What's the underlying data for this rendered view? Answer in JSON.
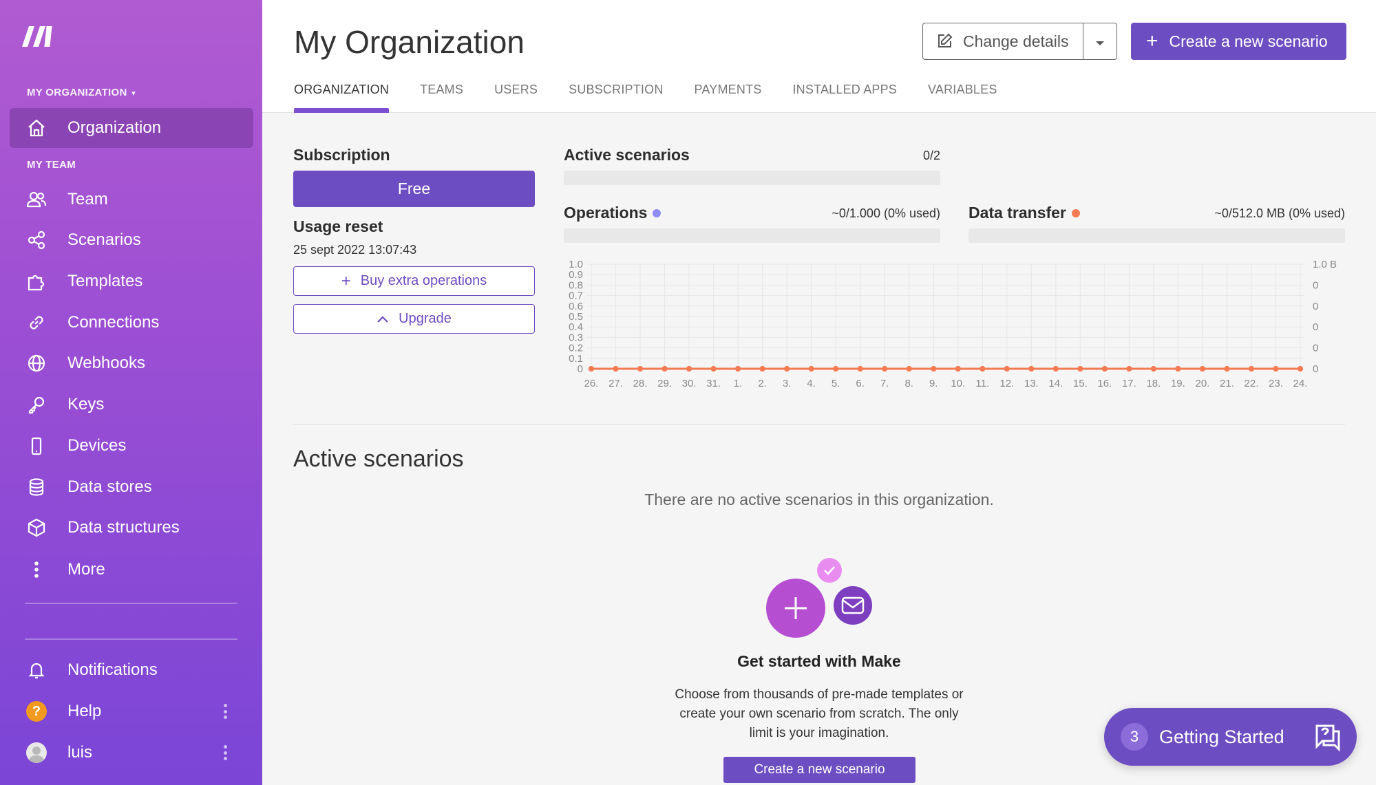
{
  "sidebar": {
    "org_section": "MY ORGANIZATION",
    "team_section": "MY TEAM",
    "items": [
      {
        "label": "Organization"
      },
      {
        "label": "Team"
      },
      {
        "label": "Scenarios"
      },
      {
        "label": "Templates"
      },
      {
        "label": "Connections"
      },
      {
        "label": "Webhooks"
      },
      {
        "label": "Keys"
      },
      {
        "label": "Devices"
      },
      {
        "label": "Data stores"
      },
      {
        "label": "Data structures"
      },
      {
        "label": "More"
      }
    ],
    "bottom": [
      {
        "label": "Notifications"
      },
      {
        "label": "Help",
        "badge": "?"
      },
      {
        "label": "luis"
      }
    ]
  },
  "header": {
    "title": "My Organization",
    "change_details": "Change details",
    "create_scenario": "Create a new scenario",
    "tabs": [
      "ORGANIZATION",
      "TEAMS",
      "USERS",
      "SUBSCRIPTION",
      "PAYMENTS",
      "INSTALLED APPS",
      "VARIABLES"
    ]
  },
  "subscription": {
    "label": "Subscription",
    "plan": "Free",
    "usage_reset_label": "Usage reset",
    "usage_reset_date": "25 sept 2022 13:07:43",
    "buy_extra": "Buy extra operations",
    "upgrade": "Upgrade"
  },
  "stats": {
    "active_scenarios_label": "Active scenarios",
    "active_scenarios_value": "0/2",
    "active_scenarios_fraction": 0,
    "operations_label": "Operations",
    "operations_value": "~0/1.000 (0% used)",
    "operations_fraction": 0,
    "data_transfer_label": "Data transfer",
    "data_transfer_value": "~0/512.0 MB (0% used)",
    "data_transfer_fraction": 0
  },
  "colors": {
    "accent": "#6d4dc2",
    "operations_dot": "#8f8cf5",
    "data_transfer_dot": "#f47a52",
    "line": "#f47a52"
  },
  "chart_data": {
    "type": "line",
    "x": [
      "26.",
      "27.",
      "28.",
      "29.",
      "30.",
      "31.",
      "1.",
      "2.",
      "3.",
      "4.",
      "5.",
      "6.",
      "7.",
      "8.",
      "9.",
      "10.",
      "11.",
      "12.",
      "13.",
      "14.",
      "15.",
      "16.",
      "17.",
      "18.",
      "19.",
      "20.",
      "21.",
      "22.",
      "23.",
      "24."
    ],
    "y_left_ticks": [
      "0",
      "0.1",
      "0.2",
      "0.3",
      "0.4",
      "0.5",
      "0.6",
      "0.7",
      "0.8",
      "0.9",
      "1.0"
    ],
    "y_right_ticks": [
      "0",
      "0",
      "0",
      "0",
      "0",
      "1.0 B"
    ],
    "ylim": [
      0,
      1
    ],
    "grid": true,
    "series": [
      {
        "values": [
          0,
          0,
          0,
          0,
          0,
          0,
          0,
          0,
          0,
          0,
          0,
          0,
          0,
          0,
          0,
          0,
          0,
          0,
          0,
          0,
          0,
          0,
          0,
          0,
          0,
          0,
          0,
          0,
          0,
          0
        ]
      },
      {
        "values": [
          0,
          0,
          0,
          0,
          0,
          0,
          0,
          0,
          0,
          0,
          0,
          0,
          0,
          0,
          0,
          0,
          0,
          0,
          0,
          0,
          0,
          0,
          0,
          0,
          0,
          0,
          0,
          0,
          0,
          0
        ]
      }
    ]
  },
  "active": {
    "title": "Active scenarios",
    "empty_message": "There are no active scenarios in this organization."
  },
  "getting_started": {
    "title": "Get started with Make",
    "description": "Choose from thousands of pre-made templates or create your own scenario from scratch. The only limit is your imagination.",
    "button": "Create a new scenario",
    "widget_count": "3",
    "widget_label": "Getting Started"
  }
}
